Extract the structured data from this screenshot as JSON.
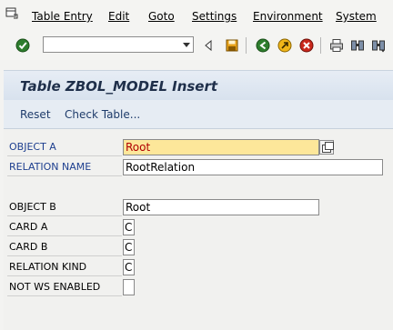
{
  "menu": {
    "items": [
      {
        "label": "Table Entry"
      },
      {
        "label": "Edit"
      },
      {
        "label": "Goto"
      },
      {
        "label": "Settings"
      },
      {
        "label": "Environment"
      },
      {
        "label": "System"
      }
    ]
  },
  "toolbar": {
    "command_field_value": "",
    "icons": [
      "enter-icon",
      "back-triangle-icon",
      "save-icon",
      "back-icon",
      "exit-icon",
      "cancel-icon",
      "print-icon",
      "find-icon",
      "find-next-icon"
    ]
  },
  "title": "Table ZBOL_MODEL Insert",
  "app_toolbar": {
    "reset_label": "Reset",
    "check_table_label": "Check Table..."
  },
  "form": {
    "object_a": {
      "label": "OBJECT A",
      "value": "Root"
    },
    "relation_name": {
      "label": "RELATION NAME",
      "value": "RootRelation"
    },
    "object_b": {
      "label": "OBJECT B",
      "value": "Root"
    },
    "card_a": {
      "label": "CARD A",
      "value": "C"
    },
    "card_b": {
      "label": "CARD B",
      "value": "C"
    },
    "relation_kind": {
      "label": "RELATION KIND",
      "value": "C"
    },
    "not_ws_enabled": {
      "label": "NOT WS ENABLED",
      "value": ""
    }
  },
  "colors": {
    "key_label": "#1e3f8f",
    "required_field_bg": "#fde79a",
    "required_field_text": "#b00000",
    "title_text": "#1f2f4a"
  }
}
